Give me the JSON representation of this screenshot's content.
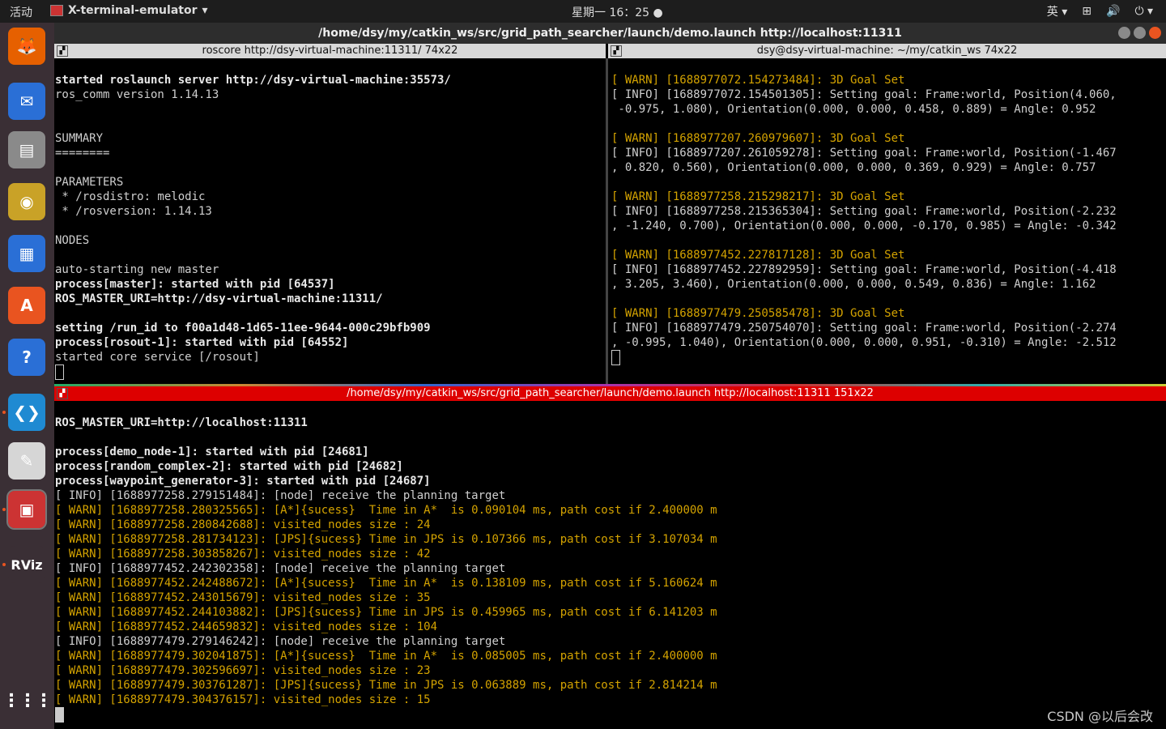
{
  "topbar": {
    "activities": "活动",
    "app_name": "X-terminal-emulator",
    "clock": "星期一 16：25",
    "input_method": "英"
  },
  "window": {
    "title": "/home/dsy/my/catkin_ws/src/grid_path_searcher/launch/demo.launch http://localhost:11311"
  },
  "pane_left": {
    "header": "roscore http://dsy-virtual-machine:11311/ 74x22",
    "lines": [
      {
        "t": "",
        "c": "info"
      },
      {
        "t": "started roslaunch server http://dsy-virtual-machine:35573/",
        "c": "bold"
      },
      {
        "t": "ros_comm version 1.14.13",
        "c": "info"
      },
      {
        "t": "",
        "c": "info"
      },
      {
        "t": "",
        "c": "info"
      },
      {
        "t": "SUMMARY",
        "c": "info"
      },
      {
        "t": "========",
        "c": "info"
      },
      {
        "t": "",
        "c": "info"
      },
      {
        "t": "PARAMETERS",
        "c": "info"
      },
      {
        "t": " * /rosdistro: melodic",
        "c": "info"
      },
      {
        "t": " * /rosversion: 1.14.13",
        "c": "info"
      },
      {
        "t": "",
        "c": "info"
      },
      {
        "t": "NODES",
        "c": "info"
      },
      {
        "t": "",
        "c": "info"
      },
      {
        "t": "auto-starting new master",
        "c": "info"
      },
      {
        "t": "process[master]: started with pid [64537]",
        "c": "bold"
      },
      {
        "t": "ROS_MASTER_URI=http://dsy-virtual-machine:11311/",
        "c": "bold"
      },
      {
        "t": "",
        "c": "info"
      },
      {
        "t": "setting /run_id to f00a1d48-1d65-11ee-9644-000c29bfb909",
        "c": "bold"
      },
      {
        "t": "process[rosout-1]: started with pid [64552]",
        "c": "bold"
      },
      {
        "t": "started core service [/rosout]",
        "c": "info"
      }
    ]
  },
  "pane_right": {
    "header": "dsy@dsy-virtual-machine: ~/my/catkin_ws 74x22",
    "lines": [
      {
        "t": "",
        "c": "info"
      },
      {
        "t": "[ WARN] [1688977072.154273484]: 3D Goal Set",
        "c": "warn"
      },
      {
        "t": "[ INFO] [1688977072.154501305]: Setting goal: Frame:world, Position(4.060,",
        "c": "info"
      },
      {
        "t": " -0.975, 1.080), Orientation(0.000, 0.000, 0.458, 0.889) = Angle: 0.952",
        "c": "info"
      },
      {
        "t": "",
        "c": "info"
      },
      {
        "t": "[ WARN] [1688977207.260979607]: 3D Goal Set",
        "c": "warn"
      },
      {
        "t": "[ INFO] [1688977207.261059278]: Setting goal: Frame:world, Position(-1.467",
        "c": "info"
      },
      {
        "t": ", 0.820, 0.560), Orientation(0.000, 0.000, 0.369, 0.929) = Angle: 0.757",
        "c": "info"
      },
      {
        "t": "",
        "c": "info"
      },
      {
        "t": "[ WARN] [1688977258.215298217]: 3D Goal Set",
        "c": "warn"
      },
      {
        "t": "[ INFO] [1688977258.215365304]: Setting goal: Frame:world, Position(-2.232",
        "c": "info"
      },
      {
        "t": ", -1.240, 0.700), Orientation(0.000, 0.000, -0.170, 0.985) = Angle: -0.342",
        "c": "info"
      },
      {
        "t": "",
        "c": "info"
      },
      {
        "t": "[ WARN] [1688977452.227817128]: 3D Goal Set",
        "c": "warn"
      },
      {
        "t": "[ INFO] [1688977452.227892959]: Setting goal: Frame:world, Position(-4.418",
        "c": "info"
      },
      {
        "t": ", 3.205, 3.460), Orientation(0.000, 0.000, 0.549, 0.836) = Angle: 1.162",
        "c": "info"
      },
      {
        "t": "",
        "c": "info"
      },
      {
        "t": "[ WARN] [1688977479.250585478]: 3D Goal Set",
        "c": "warn"
      },
      {
        "t": "[ INFO] [1688977479.250754070]: Setting goal: Frame:world, Position(-2.274",
        "c": "info"
      },
      {
        "t": ", -0.995, 1.040), Orientation(0.000, 0.000, 0.951, -0.310) = Angle: -2.512",
        "c": "info"
      }
    ]
  },
  "pane_bottom": {
    "header": "/home/dsy/my/catkin_ws/src/grid_path_searcher/launch/demo.launch http://localhost:11311 151x22",
    "lines": [
      {
        "t": "",
        "c": "info"
      },
      {
        "t": "ROS_MASTER_URI=http://localhost:11311",
        "c": "bold"
      },
      {
        "t": "",
        "c": "info"
      },
      {
        "t": "process[demo_node-1]: started with pid [24681]",
        "c": "bold"
      },
      {
        "t": "process[random_complex-2]: started with pid [24682]",
        "c": "bold"
      },
      {
        "t": "process[waypoint_generator-3]: started with pid [24687]",
        "c": "bold"
      },
      {
        "t": "[ INFO] [1688977258.279151484]: [node] receive the planning target",
        "c": "info"
      },
      {
        "t": "[ WARN] [1688977258.280325565]: [A*]{sucess}  Time in A*  is 0.090104 ms, path cost if 2.400000 m",
        "c": "warn"
      },
      {
        "t": "[ WARN] [1688977258.280842688]: visited_nodes size : 24",
        "c": "warn"
      },
      {
        "t": "[ WARN] [1688977258.281734123]: [JPS]{sucess} Time in JPS is 0.107366 ms, path cost if 3.107034 m",
        "c": "warn"
      },
      {
        "t": "[ WARN] [1688977258.303858267]: visited_nodes size : 42",
        "c": "warn"
      },
      {
        "t": "[ INFO] [1688977452.242302358]: [node] receive the planning target",
        "c": "info"
      },
      {
        "t": "[ WARN] [1688977452.242488672]: [A*]{sucess}  Time in A*  is 0.138109 ms, path cost if 5.160624 m",
        "c": "warn"
      },
      {
        "t": "[ WARN] [1688977452.243015679]: visited_nodes size : 35",
        "c": "warn"
      },
      {
        "t": "[ WARN] [1688977452.244103882]: [JPS]{sucess} Time in JPS is 0.459965 ms, path cost if 6.141203 m",
        "c": "warn"
      },
      {
        "t": "[ WARN] [1688977452.244659832]: visited_nodes size : 104",
        "c": "warn"
      },
      {
        "t": "[ INFO] [1688977479.279146242]: [node] receive the planning target",
        "c": "info"
      },
      {
        "t": "[ WARN] [1688977479.302041875]: [A*]{sucess}  Time in A*  is 0.085005 ms, path cost if 2.400000 m",
        "c": "warn"
      },
      {
        "t": "[ WARN] [1688977479.302596697]: visited_nodes size : 23",
        "c": "warn"
      },
      {
        "t": "[ WARN] [1688977479.303761287]: [JPS]{sucess} Time in JPS is 0.063889 ms, path cost if 2.814214 m",
        "c": "warn"
      },
      {
        "t": "[ WARN] [1688977479.304376157]: visited_nodes size : 15",
        "c": "warn"
      }
    ]
  },
  "dock": {
    "items": [
      {
        "name": "firefox-icon",
        "color": "#e66000",
        "glyph": "🦊"
      },
      {
        "name": "thunderbird-icon",
        "color": "#2a6fd6",
        "glyph": "✉"
      },
      {
        "name": "files-icon",
        "color": "#8a8a8a",
        "glyph": "▤"
      },
      {
        "name": "rhythmbox-icon",
        "color": "#c9a227",
        "glyph": "◉"
      },
      {
        "name": "libreoffice-writer-icon",
        "color": "#2a6fd6",
        "glyph": "▦"
      },
      {
        "name": "software-center-icon",
        "color": "#e95420",
        "glyph": "A"
      },
      {
        "name": "help-icon",
        "color": "#2a6fd6",
        "glyph": "?"
      },
      {
        "name": "vscode-icon",
        "color": "#1f8ad2",
        "glyph": "❮❯"
      },
      {
        "name": "document-viewer-icon",
        "color": "#d6d6d6",
        "glyph": "✎"
      },
      {
        "name": "terminator-icon",
        "color": "#c33",
        "glyph": "▣"
      },
      {
        "name": "rviz-icon",
        "color": "#3a2f35",
        "glyph": "RViz"
      }
    ],
    "apps_grid_glyph": "⋮⋮⋮"
  },
  "watermark": "CSDN @以后会改"
}
